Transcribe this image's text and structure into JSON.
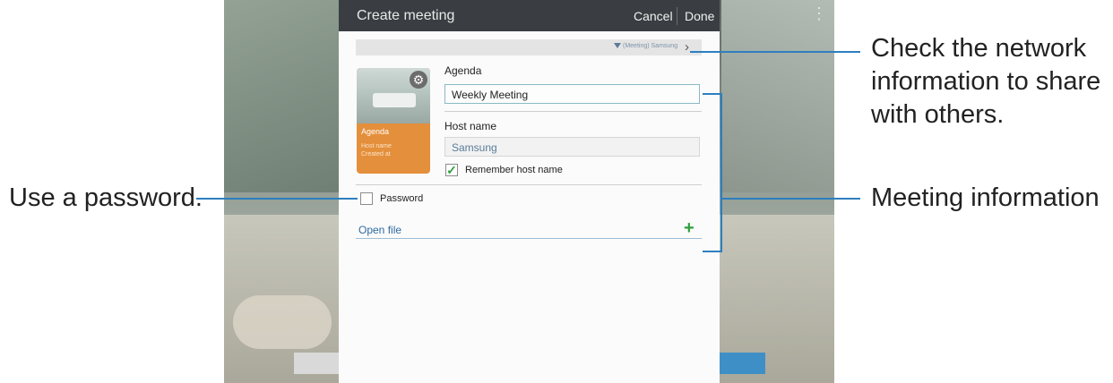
{
  "dialog": {
    "title": "Create meeting",
    "cancel_label": "Cancel",
    "done_label": "Done",
    "network_info": "(Meeting) Samsung",
    "thumbnail": {
      "agenda": "Agenda",
      "host_name": "Host name",
      "created_at": "Created at"
    },
    "agenda_label": "Agenda",
    "agenda_value": "Weekly Meeting",
    "host_label": "Host name",
    "host_value": "Samsung",
    "remember_label": "Remember host name",
    "remember_checked": true,
    "password_label": "Password",
    "password_checked": false,
    "open_file_label": "Open file"
  },
  "callouts": {
    "network": [
      "Check the network",
      "information to share",
      "with others."
    ],
    "meeting_info": "Meeting information",
    "password": "Use a password."
  },
  "colors": {
    "titlebar": "#3a3e42",
    "thumbnail_accent": "#e48f3b",
    "checkbox_check": "#2e9f3e",
    "link": "#2d6aa0",
    "callout_line": "#2d7fbf"
  }
}
